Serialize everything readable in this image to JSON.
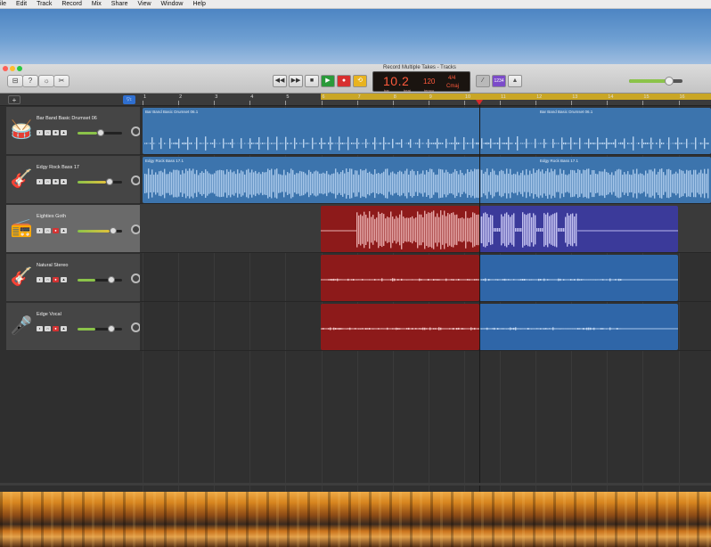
{
  "menu": [
    "ile",
    "Edit",
    "Track",
    "Record",
    "Mix",
    "Share",
    "View",
    "Window",
    "Help"
  ],
  "window": {
    "title": "Record Multiple Takes - Tracks"
  },
  "toolbar": {
    "left_icons": [
      "library-icon",
      "quick-help-icon",
      "smart-controls-icon",
      "editors-icon"
    ],
    "rewind_label": "◀◀",
    "forward_label": "▶▶",
    "stop_label": "■",
    "play_label": "▶",
    "record_label": "●",
    "cycle_label": "⟲",
    "tuner_label": "⁄",
    "count_in_label": "1234",
    "metronome_label": "▲"
  },
  "lcd": {
    "position": "10.2",
    "position_sub_left": "bar",
    "position_sub_right": "beat",
    "tempo": "120",
    "tempo_sub": "tempo",
    "time_sig": "4/4",
    "key": "Cmaj"
  },
  "ruler": {
    "bars": [
      "1",
      "2",
      "3",
      "4",
      "5",
      "6",
      "7",
      "8",
      "9",
      "10",
      "11",
      "12",
      "13",
      "14",
      "15",
      "16"
    ]
  },
  "header": {
    "add_label": "+",
    "filter_label": "▽↕"
  },
  "tracks": [
    {
      "name": "Bar Band Basic Drumset 06",
      "icon": "drum-kit-icon"
    },
    {
      "name": "Edgy Rock Bass 17",
      "icon": "bass-guitar-icon"
    },
    {
      "name": "Eighties Goth",
      "icon": "amp-icon"
    },
    {
      "name": "Natural Stereo",
      "icon": "acoustic-guitar-icon"
    },
    {
      "name": "Edge Vocal",
      "icon": "microphone-icon"
    }
  ],
  "regions": {
    "drums_a": "Bar Band Basic Drumset 06.1",
    "drums_b": "Bar Band Basic Drumset 06.1",
    "bass_a": "Edgy Rock Bass 17.1",
    "bass_b": "Edgy Rock Bass 17.1"
  },
  "colors": {
    "blue_region": "#3c74ad",
    "red_region": "#8d1a1a",
    "purple_region": "#3b3a9a",
    "cycle_yellow": "#c9a626",
    "playhead": "#d32b2b"
  }
}
